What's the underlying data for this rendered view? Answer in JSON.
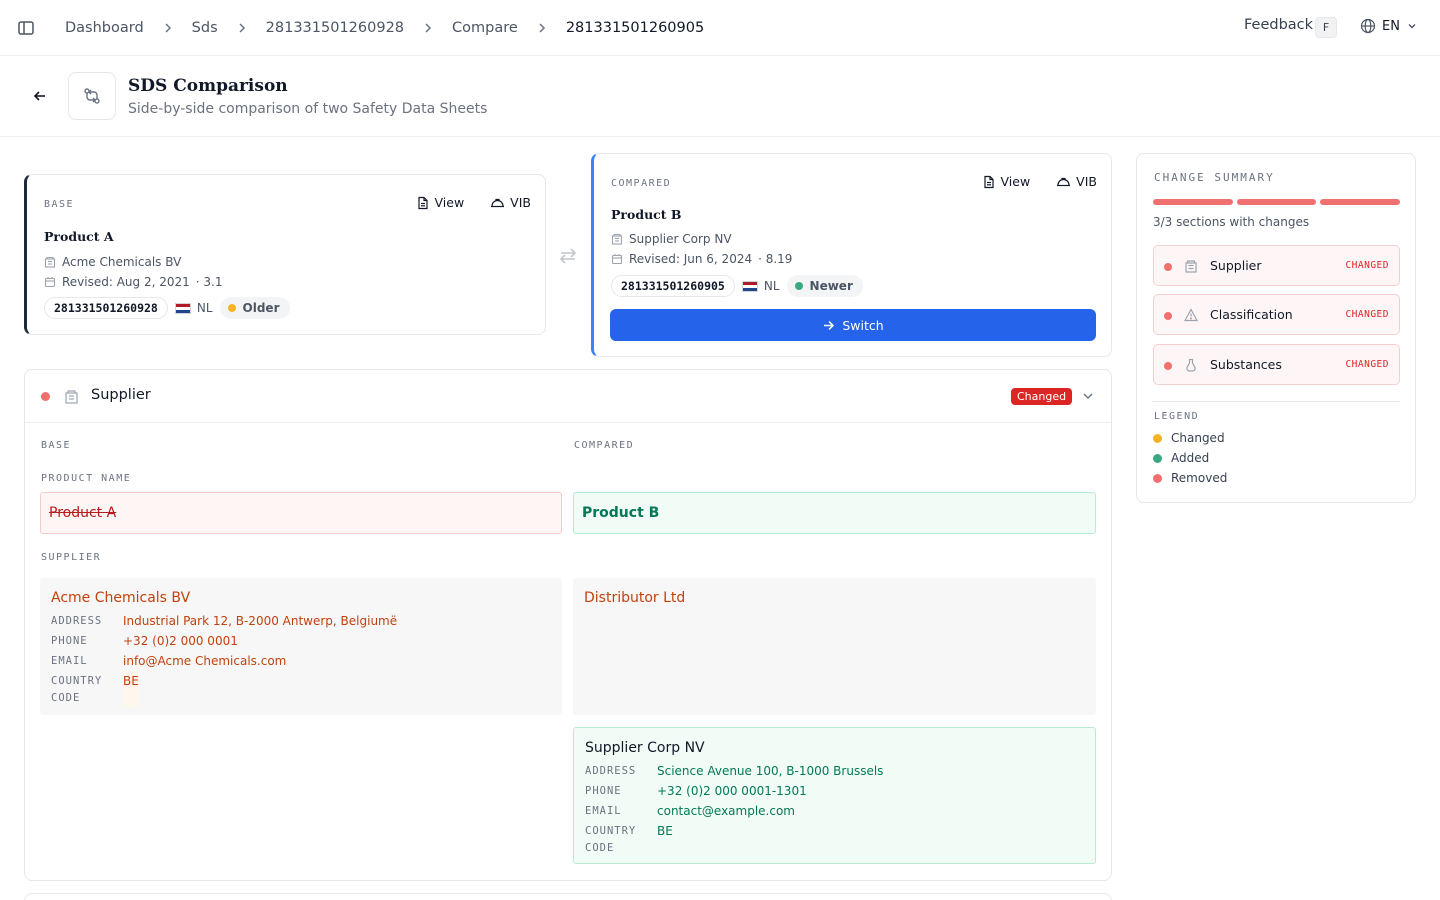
{
  "breadcrumbs": [
    "Dashboard",
    "Sds",
    "281331501260928",
    "Compare",
    "281331501260905"
  ],
  "topbar": {
    "feedback": "Feedback",
    "feedback_key": "F",
    "language": "EN"
  },
  "page": {
    "title": "SDS Comparison",
    "subtitle": "Side-by-side comparison of two Safety Data Sheets"
  },
  "base_card": {
    "label": "BASE",
    "product": "Product A",
    "supplier": "Acme Chemicals BV",
    "revised": "Revised: Aug 2, 2021",
    "version": "· 3.1",
    "id": "281331501260928",
    "country": "NL",
    "status": "Older",
    "status_color": "#f5b323",
    "view_label": "View",
    "vib_label": "VIB"
  },
  "compared_card": {
    "label": "COMPARED",
    "product": "Product B",
    "supplier": "Supplier Corp NV",
    "revised": "Revised: Jun 6, 2024",
    "version": "· 8.19",
    "id": "281331501260905",
    "country": "NL",
    "status": "Newer",
    "status_color": "#3aa981",
    "view_label": "View",
    "vib_label": "VIB",
    "switch_label": "Switch"
  },
  "section": {
    "title": "Supplier",
    "badge": "Changed",
    "col_base": "BASE",
    "col_compared": "COMPARED",
    "product_name_label": "PRODUCT NAME",
    "product_name_base": "Product A",
    "product_name_compared": "Product B",
    "supplier_label": "SUPPLIER",
    "base_supplier": {
      "name": "Acme Chemicals BV",
      "address_key": "ADDRESS",
      "address": "Industrial Park 12, B-2000 Antwerp, Belgiumë",
      "phone_key": "PHONE",
      "phone": "+32 (0)2 000 0001",
      "email_key": "EMAIL",
      "email": "info@Acme Chemicals.com",
      "country_key_1": "COUNTRY",
      "country_key_2": "CODE",
      "country": "BE"
    },
    "compared_supplier_1": {
      "name": "Distributor Ltd"
    },
    "compared_supplier_2": {
      "name": "Supplier Corp NV",
      "address_key": "ADDRESS",
      "address": "Science Avenue 100, B-1000 Brussels",
      "phone_key": "PHONE",
      "phone": "+32 (0)2 000 0001-1301",
      "email_key": "EMAIL",
      "email": "contact@example.com",
      "country_key_1": "COUNTRY",
      "country_key_2": "CODE",
      "country": "BE"
    }
  },
  "summary": {
    "title": "CHANGE SUMMARY",
    "count": "3/3 sections with changes",
    "items": [
      {
        "label": "Supplier",
        "badge": "CHANGED",
        "icon": "building-icon"
      },
      {
        "label": "Classification",
        "badge": "CHANGED",
        "icon": "warning-icon"
      },
      {
        "label": "Substances",
        "badge": "CHANGED",
        "icon": "flask-icon"
      }
    ],
    "legend_title": "LEGEND",
    "legend": [
      {
        "label": "Changed",
        "color": "#f5b323"
      },
      {
        "label": "Added",
        "color": "#3aa981"
      },
      {
        "label": "Removed",
        "color": "#f07070"
      }
    ]
  }
}
